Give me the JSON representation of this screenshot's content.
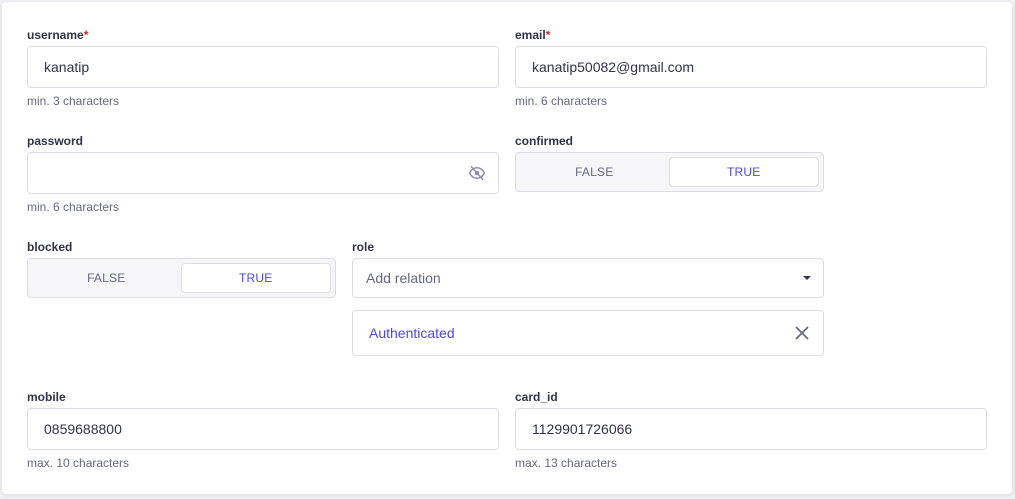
{
  "username": {
    "label": "username",
    "required": "*",
    "value": "kanatip",
    "hint": "min. 3 characters"
  },
  "email": {
    "label": "email",
    "required": "*",
    "value": "kanatip50082@gmail.com",
    "hint": "min. 6 characters"
  },
  "password": {
    "label": "password",
    "value": "",
    "hint": "min. 6 characters",
    "icon": "eye-off-icon"
  },
  "confirmed": {
    "label": "confirmed",
    "false_label": "FALSE",
    "true_label": "TRUE",
    "selected": "TRUE"
  },
  "blocked": {
    "label": "blocked",
    "false_label": "FALSE",
    "true_label": "TRUE",
    "selected": "TRUE"
  },
  "role": {
    "label": "role",
    "placeholder": "Add relation",
    "selected_relation": "Authenticated"
  },
  "mobile": {
    "label": "mobile",
    "value": "0859688800",
    "hint": "max. 10 characters"
  },
  "card_id": {
    "label": "card_id",
    "value": "1129901726066",
    "hint": "max. 13 characters"
  },
  "colors": {
    "accent": "#4945ff",
    "required": "#d02b20",
    "border": "#dcdce4",
    "muted": "#666687"
  }
}
